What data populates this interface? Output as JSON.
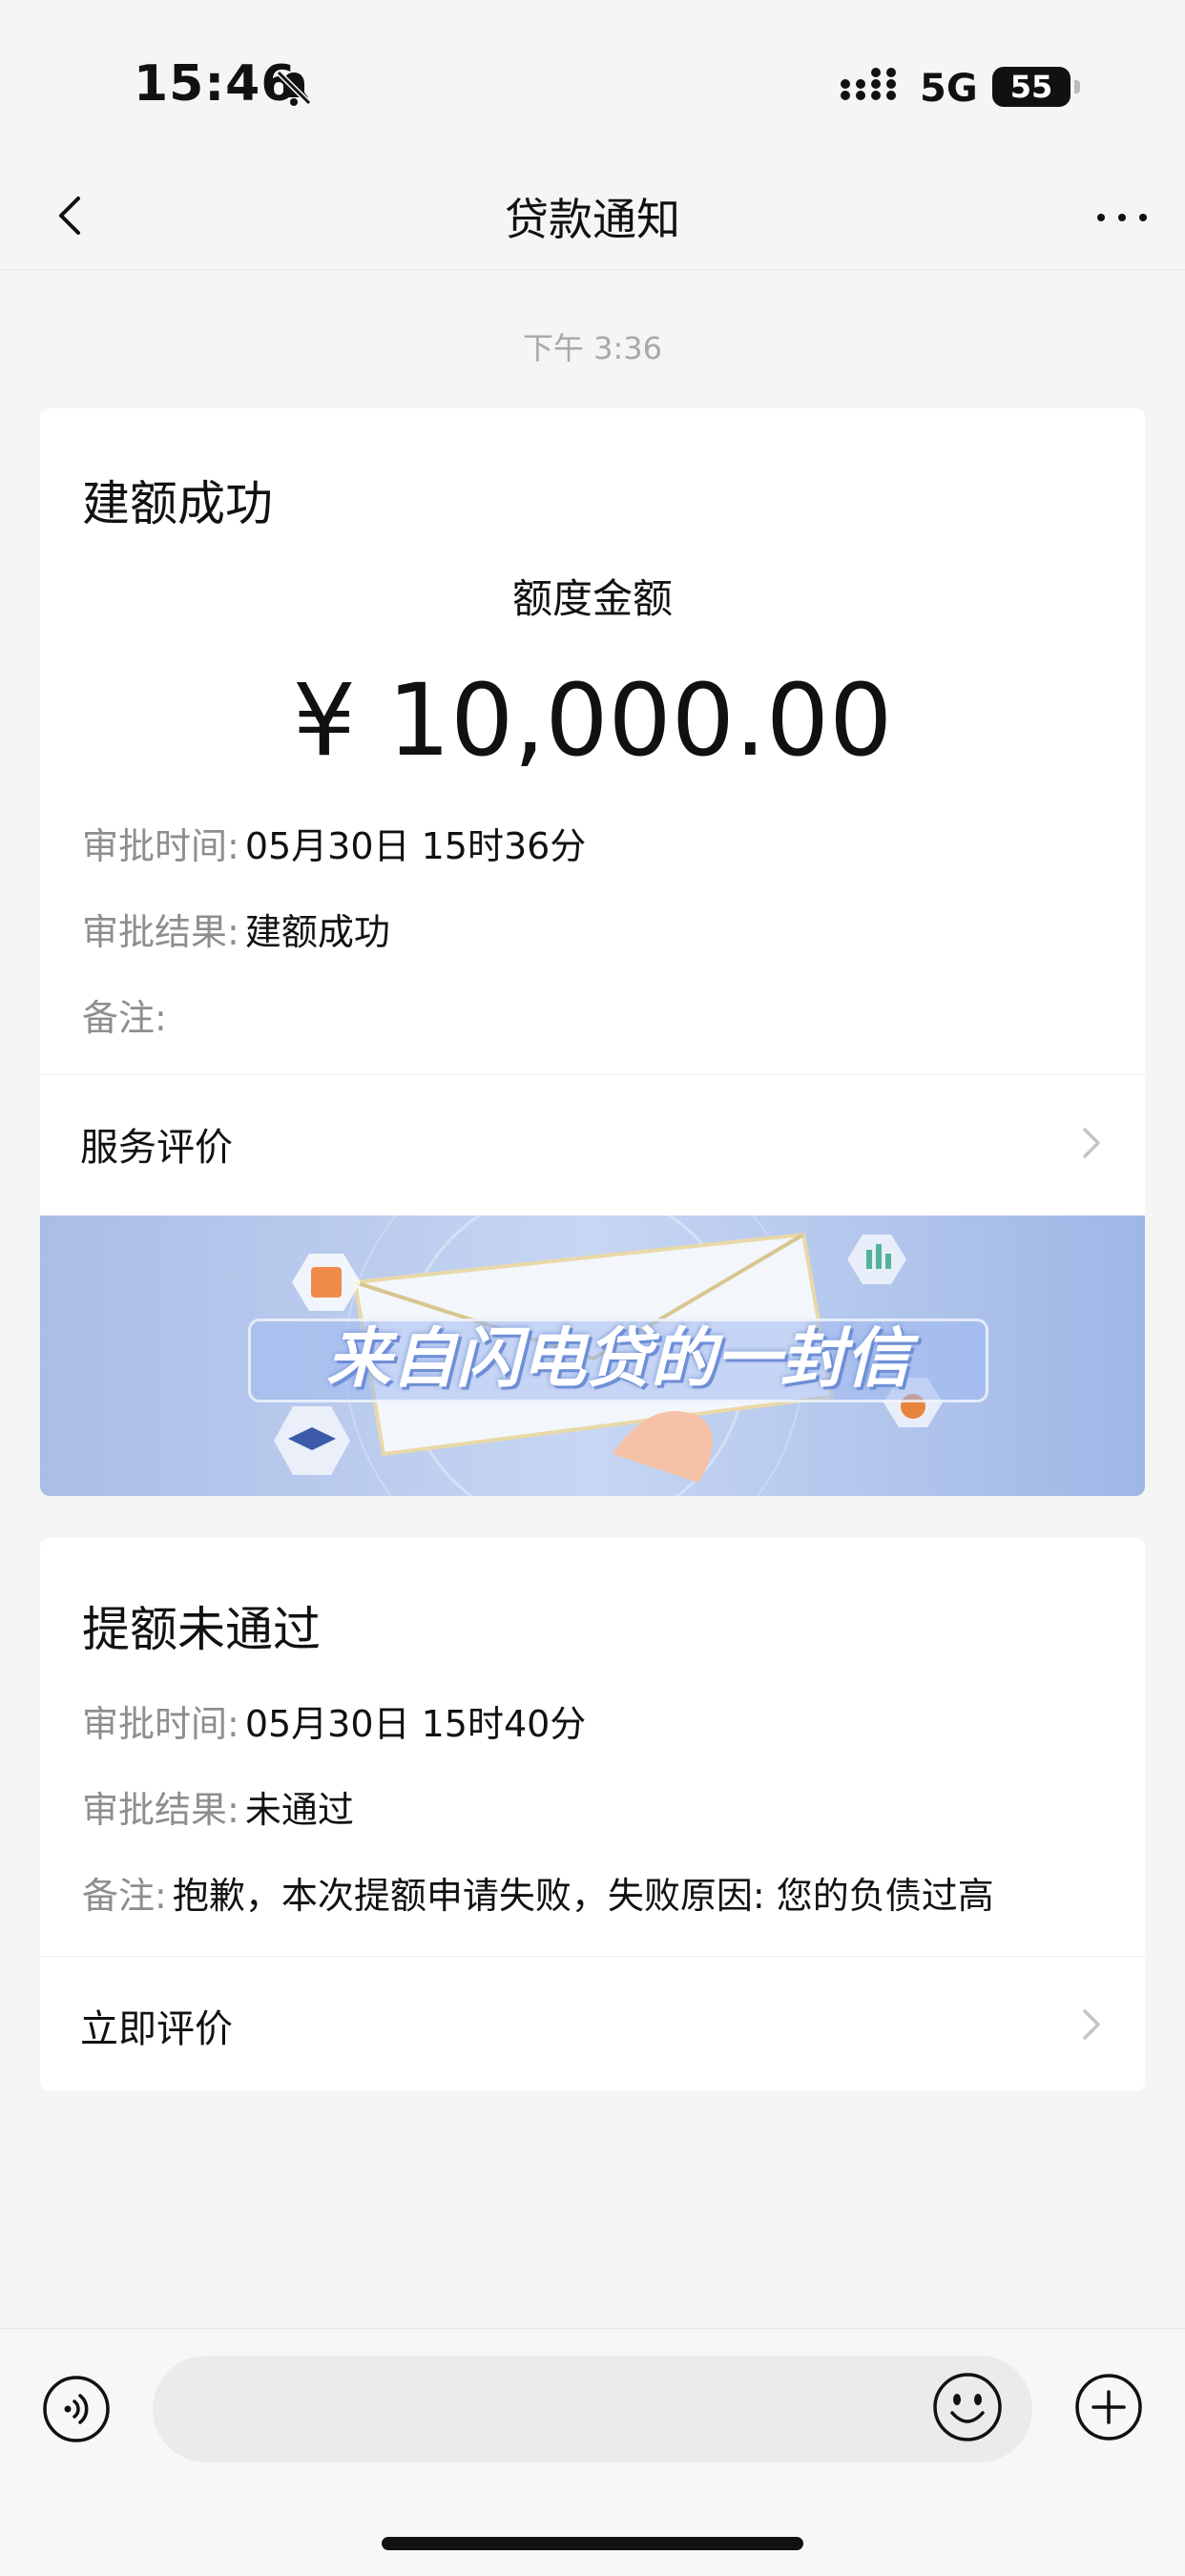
{
  "status_bar": {
    "time": "15:46",
    "network": "5G",
    "battery": "55"
  },
  "nav": {
    "title": "贷款通知"
  },
  "timestamp": "下午 3:36",
  "card1": {
    "title": "建额成功",
    "amount_label": "额度金额",
    "amount": "¥ 10,000.00",
    "approval_time_key": "审批时间:",
    "approval_time_val": "05月30日 15时36分",
    "result_key": "审批结果:",
    "result_val": "建额成功",
    "note_key": "备注:",
    "note_val": "",
    "service_rating": "服务评价",
    "banner_text": "来自闪电贷的一封信"
  },
  "card2": {
    "title": "提额未通过",
    "approval_time_key": "审批时间:",
    "approval_time_val": "05月30日 15时40分",
    "result_key": "审批结果:",
    "result_val": "未通过",
    "note_key": "备注:",
    "note_val": "抱歉，本次提额申请失败，失败原因: 您的负债过高",
    "rate_now": "立即评价"
  },
  "icons": {
    "back": "chevron-left-icon",
    "more": "more-dots-icon",
    "voice": "voice-icon",
    "emoji": "emoji-icon",
    "plus": "plus-icon"
  }
}
